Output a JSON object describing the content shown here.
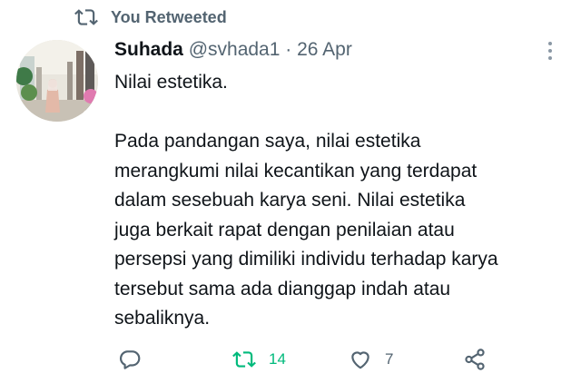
{
  "context": {
    "label": "You Retweeted",
    "icon": "retweet-icon"
  },
  "tweet": {
    "author_name": "Suhada",
    "author_handle": "@svhada1",
    "separator": "·",
    "date": "26 Apr",
    "paragraph1": "Nilai estetika.",
    "paragraph2_lines": [
      "Pada pandangan saya, nilai estetika",
      "merangkumi nilai kecantikan yang terdapat",
      "dalam sesebuah karya seni. Nilai estetika",
      "juga berkait rapat dengan penilaian atau",
      "persepsi yang dimiliki individu terhadap karya",
      "tersebut sama ada dianggap indah atau",
      "sebaliknya."
    ]
  },
  "actions": {
    "reply": {
      "icon": "reply-icon"
    },
    "retweet": {
      "icon": "retweet-icon",
      "count": "14",
      "active": true
    },
    "like": {
      "icon": "heart-icon",
      "count": "7"
    },
    "share": {
      "icon": "share-icon"
    }
  },
  "colors": {
    "text": "#0f1419",
    "muted": "#536471",
    "retweet_active": "#00ba7c"
  }
}
